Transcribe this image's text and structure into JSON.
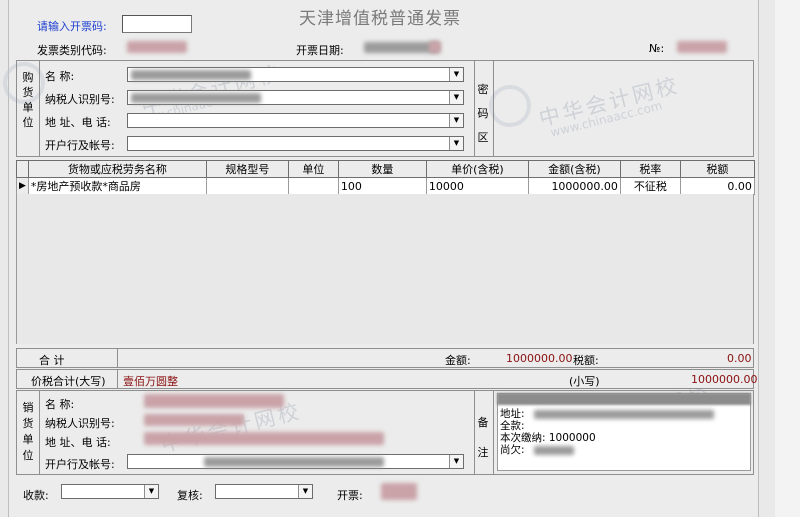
{
  "title": "天津增值税普通发票",
  "header": {
    "code_input_label": "请输入开票码:",
    "type_code_label": "发票类别代码:",
    "date_label": "开票日期:",
    "no_label": "№:"
  },
  "buyer": {
    "section_label": [
      "购",
      "货",
      "单",
      "位"
    ],
    "name_label": "名      称:",
    "tax_id_label": "纳税人识别号:",
    "address_label": "地 址、电 话:",
    "bank_label": "开户行及帐号:",
    "cipher_label": [
      "密",
      "码",
      "区"
    ]
  },
  "items_table": {
    "headers": [
      "货物或应税劳务名称",
      "规格型号",
      "单位",
      "数量",
      "单价(含税)",
      "金额(含税)",
      "税率",
      "税额"
    ],
    "row": {
      "name": "*房地产预收款*商品房",
      "spec": "",
      "unit": "",
      "qty": "100",
      "price": "10000",
      "amount": "1000000.00",
      "rate": "不征税",
      "tax": "0.00"
    },
    "row_indicator": "▶"
  },
  "totals": {
    "label": "合        计",
    "amount_label": "金额:",
    "amount_value": "1000000.00",
    "tax_label": "税额:",
    "tax_value": "0.00"
  },
  "grand_total": {
    "label": "价税合计(大写)",
    "uppercase_value": "壹佰万圆整",
    "lower_label": "(小写)",
    "lower_value": "1000000.00"
  },
  "seller": {
    "section_label": [
      "销",
      "货",
      "单",
      "位"
    ],
    "name_label": "名      称:",
    "tax_id_label": "纳税人识别号:",
    "address_label": "地 址、电 话:",
    "bank_label": "开户行及帐号:",
    "remark_label": [
      "备",
      "注"
    ],
    "remarks": [
      "地址:",
      "全款:",
      "本次缴纳: 1000000",
      "尚欠:"
    ]
  },
  "footer": {
    "payee_label": "收款:",
    "reviewer_label": "复核:",
    "drawer_label": "开票:"
  },
  "watermark": {
    "text": "中华会计网校",
    "url": "www.chinaacc.com"
  }
}
